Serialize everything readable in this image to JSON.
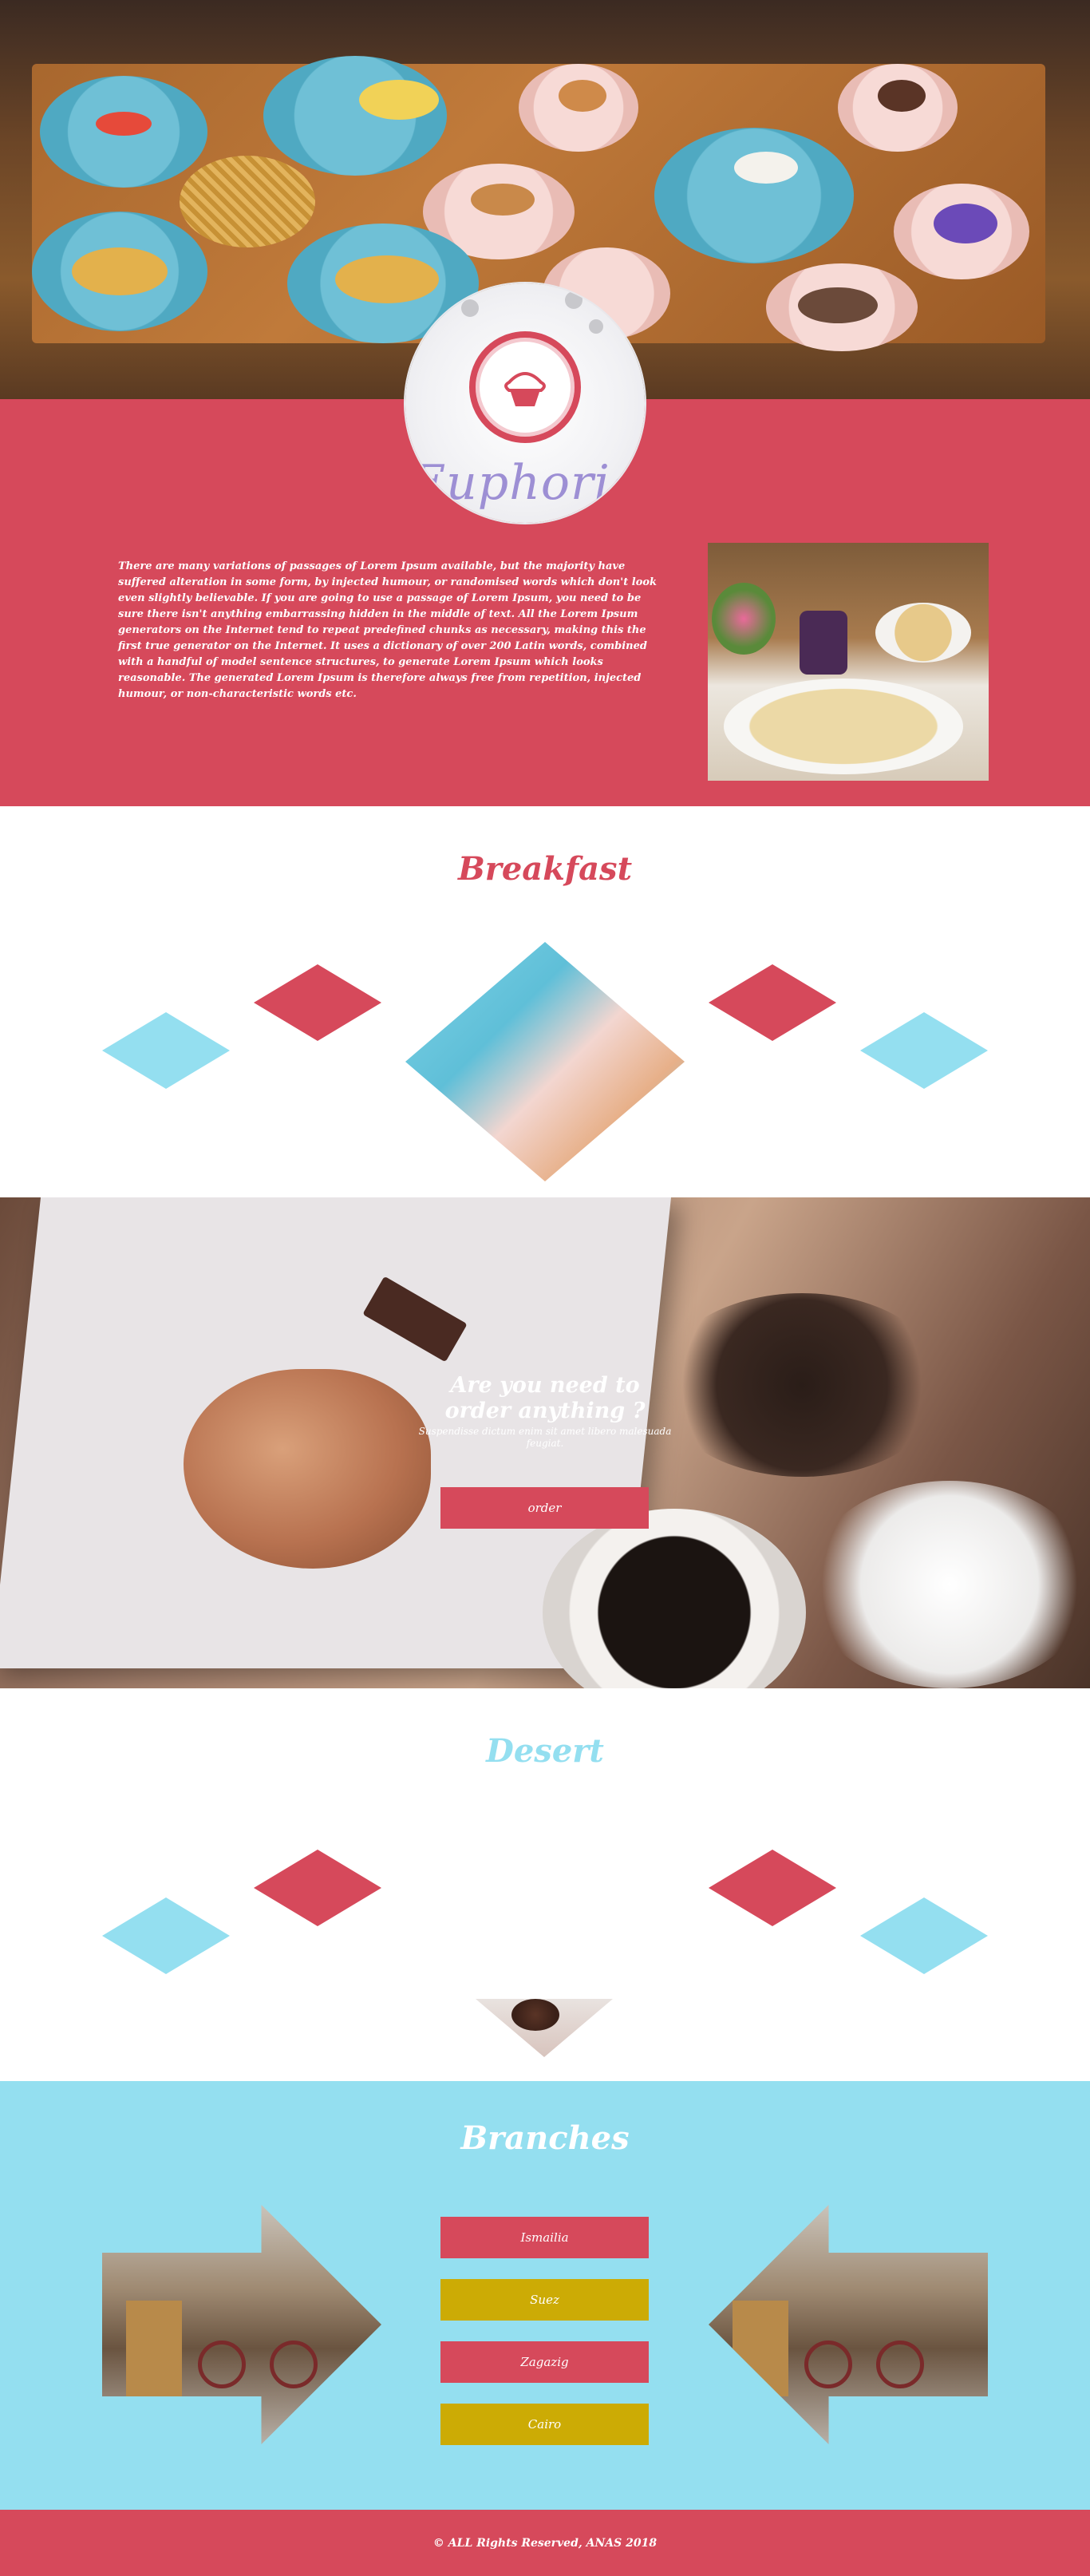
{
  "logo": {
    "name": "Euphoria",
    "icon": "cupcake-icon"
  },
  "about": {
    "text": "There are many variations of passages of Lorem Ipsum available, but the majority have suffered alteration in some form, by injected humour, or randomised words which don't look even slightly believable. If you are going to use a passage of Lorem Ipsum, you need to be sure there isn't anything embarrassing hidden in the middle of text. All the Lorem Ipsum generators on the Internet tend to repeat predefined chunks as necessary, making this the first true generator on the Internet. It uses a dictionary of over 200 Latin words, combined with a handful of model sentence structures, to generate Lorem Ipsum which looks reasonable. The generated Lorem Ipsum is therefore always free from repetition, injected humour, or non-characteristic words etc."
  },
  "breakfast": {
    "title": "Breakfast"
  },
  "order": {
    "question": "Are you need to order anything ?",
    "subtitle": "Suspendisse dictum enim sit amet libero malesuada feugiat.",
    "button_label": "order"
  },
  "desert": {
    "title": "Desert"
  },
  "branches": {
    "title": "Branches",
    "items": [
      {
        "label": "Ismailia",
        "color": "#d6495b"
      },
      {
        "label": "Suez",
        "color": "#ccab05"
      },
      {
        "label": "Zagazig",
        "color": "#d6495b"
      },
      {
        "label": "Cairo",
        "color": "#ccab05"
      }
    ]
  },
  "footer": {
    "text": "© ALL Rights Reserved, ANAS 2018"
  },
  "colors": {
    "accent_red": "#d6495b",
    "accent_blue": "#94dff0",
    "accent_gold": "#ccab05"
  }
}
